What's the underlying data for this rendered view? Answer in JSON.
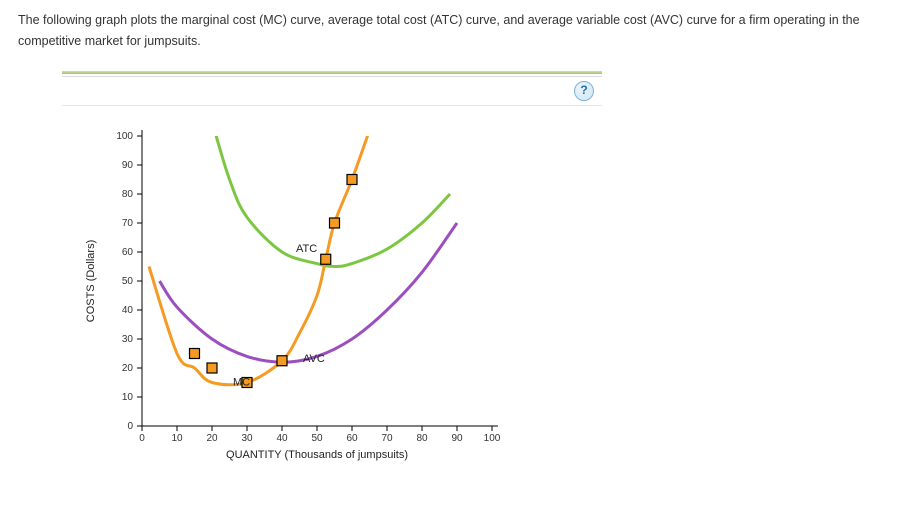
{
  "prompt_text": "The following graph plots the marginal cost (MC) curve, average total cost (ATC) curve, and average variable cost (AVC) curve for a firm operating in the competitive market for jumpsuits.",
  "toolbar": {
    "help_tooltip": "?"
  },
  "chart_data": {
    "type": "line",
    "title": "",
    "xlabel": "QUANTITY (Thousands of jumpsuits)",
    "ylabel": "COSTS (Dollars)",
    "xlim": [
      0,
      100
    ],
    "ylim": [
      0,
      100
    ],
    "x_ticks": [
      0,
      10,
      20,
      30,
      40,
      50,
      60,
      70,
      80,
      90,
      100
    ],
    "y_ticks": [
      0,
      10,
      20,
      30,
      40,
      50,
      60,
      70,
      80,
      90,
      100
    ],
    "series": [
      {
        "name": "MC",
        "color": "#f59a23",
        "label_at": {
          "x": 26,
          "y": 14
        },
        "values": [
          {
            "x": 2,
            "y": 55
          },
          {
            "x": 10,
            "y": 25
          },
          {
            "x": 15,
            "y": 20
          },
          {
            "x": 20,
            "y": 15
          },
          {
            "x": 30,
            "y": 15
          },
          {
            "x": 40,
            "y": 22.5
          },
          {
            "x": 45,
            "y": 32
          },
          {
            "x": 50,
            "y": 45
          },
          {
            "x": 52.5,
            "y": 57.5
          },
          {
            "x": 55,
            "y": 70
          },
          {
            "x": 60,
            "y": 85
          },
          {
            "x": 65,
            "y": 102
          }
        ],
        "markers": [
          {
            "x": 15,
            "y": 25
          },
          {
            "x": 20,
            "y": 20
          },
          {
            "x": 30,
            "y": 15
          },
          {
            "x": 40,
            "y": 22.5
          },
          {
            "x": 52.5,
            "y": 57.5
          },
          {
            "x": 55,
            "y": 70
          },
          {
            "x": 60,
            "y": 85
          }
        ]
      },
      {
        "name": "ATC",
        "color": "#7cc742",
        "label_at": {
          "x": 44,
          "y": 60
        },
        "values": [
          {
            "x": 20,
            "y": 105
          },
          {
            "x": 25,
            "y": 85
          },
          {
            "x": 30,
            "y": 72
          },
          {
            "x": 40,
            "y": 60
          },
          {
            "x": 50,
            "y": 56
          },
          {
            "x": 55,
            "y": 55
          },
          {
            "x": 60,
            "y": 56
          },
          {
            "x": 70,
            "y": 61
          },
          {
            "x": 80,
            "y": 70
          },
          {
            "x": 88,
            "y": 80
          }
        ]
      },
      {
        "name": "AVC",
        "color": "#9b4fbf",
        "label_at": {
          "x": 46,
          "y": 22
        },
        "values": [
          {
            "x": 5,
            "y": 50
          },
          {
            "x": 10,
            "y": 41
          },
          {
            "x": 20,
            "y": 30
          },
          {
            "x": 30,
            "y": 24
          },
          {
            "x": 40,
            "y": 22
          },
          {
            "x": 50,
            "y": 24
          },
          {
            "x": 60,
            "y": 30
          },
          {
            "x": 70,
            "y": 40
          },
          {
            "x": 80,
            "y": 53
          },
          {
            "x": 90,
            "y": 70
          }
        ]
      }
    ]
  }
}
